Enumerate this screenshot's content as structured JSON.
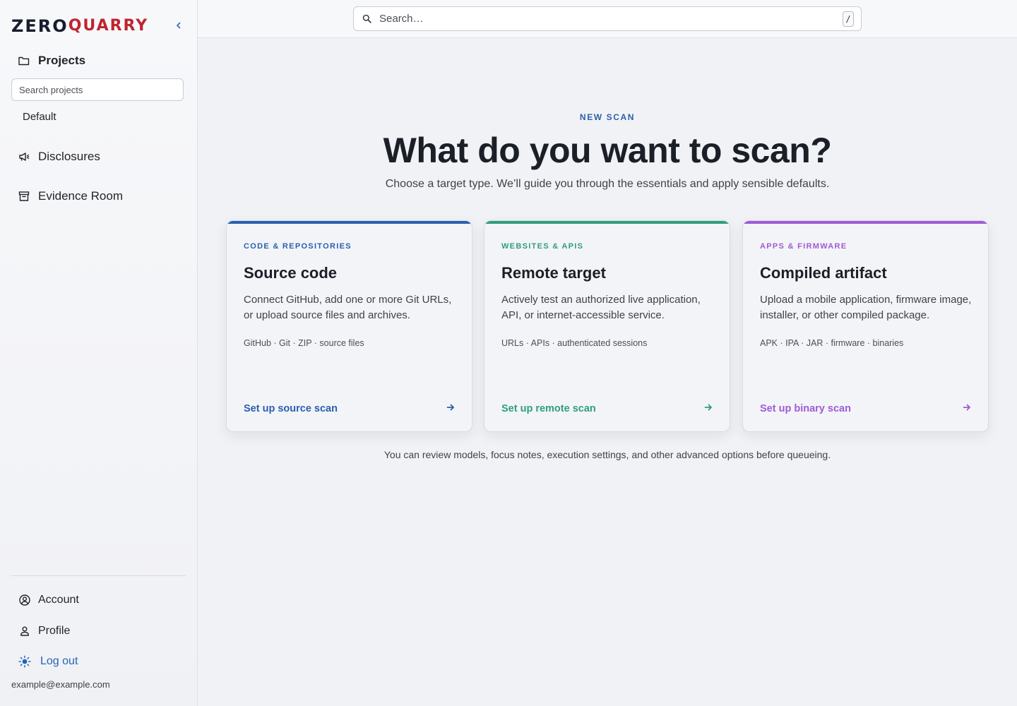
{
  "brand": {
    "logo_part1": "ZERO",
    "logo_part2": "QUARRY",
    "primary_color": "#1a1d2e",
    "accent_color": "#c0232f"
  },
  "sidebar": {
    "collapse_icon": "chevron-left-icon",
    "projects_label": "Projects",
    "project_search_placeholder": "Search projects",
    "projects": [
      "Default"
    ],
    "disclosures_label": "Disclosures",
    "evidence_label": "Evidence Room",
    "account_label": "Account",
    "profile_label": "Profile",
    "logout_label": "Log out",
    "user_email": "example@example.com"
  },
  "topbar": {
    "search_placeholder": "Search…",
    "search_shortcut": "/"
  },
  "main": {
    "eyebrow": "NEW SCAN",
    "headline": "What do you want to scan?",
    "subhead": "Choose a target type. We’ll guide you through the essentials and apply sensible defaults.",
    "footnote": "You can review models, focus notes, execution settings, and other advanced options before queueing."
  },
  "cards": [
    {
      "kicker": "CODE & REPOSITORIES",
      "title": "Source code",
      "description": "Connect GitHub, add one or more Git URLs, or upload source files and archives.",
      "tags": "GitHub · Git · ZIP · source files",
      "cta": "Set up source scan",
      "color": "#2a5fb0"
    },
    {
      "kicker": "WEBSITES & APIS",
      "title": "Remote target",
      "description": "Actively test an authorized live application, API, or internet-accessible service.",
      "tags": "URLs · APIs · authenticated sessions",
      "cta": "Set up remote scan",
      "color": "#2f9e7e"
    },
    {
      "kicker": "APPS & FIRMWARE",
      "title": "Compiled artifact",
      "description": "Upload a mobile application, firmware image, installer, or other compiled package.",
      "tags": "APK · IPA · JAR · firmware · binaries",
      "cta": "Set up binary scan",
      "color": "#a05ad6"
    }
  ]
}
